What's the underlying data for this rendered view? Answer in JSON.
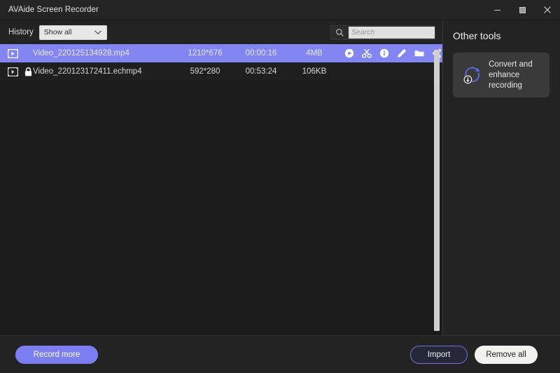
{
  "window": {
    "title": "AVAide Screen Recorder",
    "controls": [
      {
        "name": "minimize",
        "icon": "minimize-icon"
      },
      {
        "name": "maximize",
        "icon": "maximize-icon"
      },
      {
        "name": "close",
        "icon": "close-icon"
      }
    ]
  },
  "toolbar": {
    "history_label": "History",
    "filter_value": "Show all",
    "filter_options": [
      "Show all"
    ],
    "filter_icon": "chevron-down-icon",
    "search_placeholder": "Search",
    "search_value": "",
    "search_icon": "search-icon"
  },
  "list": {
    "columns": [
      "name",
      "resolution",
      "duration",
      "size"
    ],
    "rows": [
      {
        "file_icon": "video-file-icon",
        "locked": false,
        "lock_icon": "",
        "name": "Video_220125134928.mp4",
        "resolution": "1210*676",
        "duration": "00:00:16",
        "size": "4MB",
        "selected": true,
        "actions": [
          {
            "name": "play-button",
            "icon": "play-icon"
          },
          {
            "name": "trim-button",
            "icon": "scissors-icon"
          },
          {
            "name": "info-button",
            "icon": "info-icon"
          },
          {
            "name": "rename-button",
            "icon": "pencil-icon"
          },
          {
            "name": "open-folder-button",
            "icon": "folder-icon"
          },
          {
            "name": "share-button",
            "icon": "share-icon"
          },
          {
            "name": "delete-button",
            "icon": "trash-icon"
          }
        ]
      },
      {
        "file_icon": "video-file-icon",
        "locked": true,
        "lock_icon": "lock-icon",
        "name": "Video_220123172411.echmp4",
        "resolution": "592*280",
        "duration": "00:53:24",
        "size": "106KB",
        "selected": false,
        "actions": []
      }
    ]
  },
  "side_panel": {
    "title": "Other tools",
    "tools": [
      {
        "icon": "convert-recording-icon",
        "label": "Convert and enhance recording"
      }
    ]
  },
  "footer": {
    "record_label": "Record more",
    "import_label": "Import",
    "remove_label": "Remove all"
  },
  "colors": {
    "accent": "#7b7ef0",
    "selected_row": "#8285f2",
    "window_bg": "#232323",
    "list_bg": "#1b1b1b",
    "card_bg": "#3a3a3a",
    "icon_blue": "#5b6ee8"
  }
}
